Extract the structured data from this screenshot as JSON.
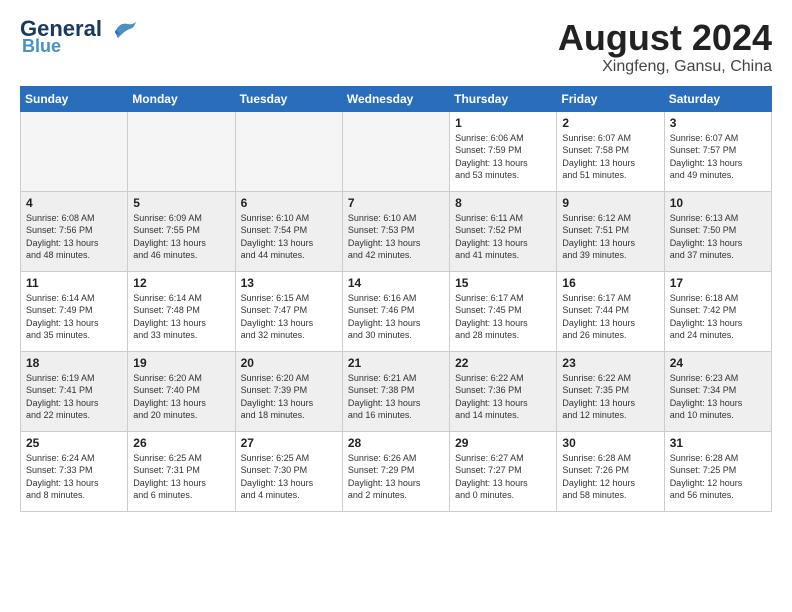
{
  "header": {
    "logo": {
      "line1": "General",
      "line2": "Blue"
    },
    "month": "August 2024",
    "location": "Xingfeng, Gansu, China"
  },
  "weekdays": [
    "Sunday",
    "Monday",
    "Tuesday",
    "Wednesday",
    "Thursday",
    "Friday",
    "Saturday"
  ],
  "weeks": [
    {
      "shaded": false,
      "days": [
        {
          "num": "",
          "info": ""
        },
        {
          "num": "",
          "info": ""
        },
        {
          "num": "",
          "info": ""
        },
        {
          "num": "",
          "info": ""
        },
        {
          "num": "1",
          "info": "Sunrise: 6:06 AM\nSunset: 7:59 PM\nDaylight: 13 hours\nand 53 minutes."
        },
        {
          "num": "2",
          "info": "Sunrise: 6:07 AM\nSunset: 7:58 PM\nDaylight: 13 hours\nand 51 minutes."
        },
        {
          "num": "3",
          "info": "Sunrise: 6:07 AM\nSunset: 7:57 PM\nDaylight: 13 hours\nand 49 minutes."
        }
      ]
    },
    {
      "shaded": true,
      "days": [
        {
          "num": "4",
          "info": "Sunrise: 6:08 AM\nSunset: 7:56 PM\nDaylight: 13 hours\nand 48 minutes."
        },
        {
          "num": "5",
          "info": "Sunrise: 6:09 AM\nSunset: 7:55 PM\nDaylight: 13 hours\nand 46 minutes."
        },
        {
          "num": "6",
          "info": "Sunrise: 6:10 AM\nSunset: 7:54 PM\nDaylight: 13 hours\nand 44 minutes."
        },
        {
          "num": "7",
          "info": "Sunrise: 6:10 AM\nSunset: 7:53 PM\nDaylight: 13 hours\nand 42 minutes."
        },
        {
          "num": "8",
          "info": "Sunrise: 6:11 AM\nSunset: 7:52 PM\nDaylight: 13 hours\nand 41 minutes."
        },
        {
          "num": "9",
          "info": "Sunrise: 6:12 AM\nSunset: 7:51 PM\nDaylight: 13 hours\nand 39 minutes."
        },
        {
          "num": "10",
          "info": "Sunrise: 6:13 AM\nSunset: 7:50 PM\nDaylight: 13 hours\nand 37 minutes."
        }
      ]
    },
    {
      "shaded": false,
      "days": [
        {
          "num": "11",
          "info": "Sunrise: 6:14 AM\nSunset: 7:49 PM\nDaylight: 13 hours\nand 35 minutes."
        },
        {
          "num": "12",
          "info": "Sunrise: 6:14 AM\nSunset: 7:48 PM\nDaylight: 13 hours\nand 33 minutes."
        },
        {
          "num": "13",
          "info": "Sunrise: 6:15 AM\nSunset: 7:47 PM\nDaylight: 13 hours\nand 32 minutes."
        },
        {
          "num": "14",
          "info": "Sunrise: 6:16 AM\nSunset: 7:46 PM\nDaylight: 13 hours\nand 30 minutes."
        },
        {
          "num": "15",
          "info": "Sunrise: 6:17 AM\nSunset: 7:45 PM\nDaylight: 13 hours\nand 28 minutes."
        },
        {
          "num": "16",
          "info": "Sunrise: 6:17 AM\nSunset: 7:44 PM\nDaylight: 13 hours\nand 26 minutes."
        },
        {
          "num": "17",
          "info": "Sunrise: 6:18 AM\nSunset: 7:42 PM\nDaylight: 13 hours\nand 24 minutes."
        }
      ]
    },
    {
      "shaded": true,
      "days": [
        {
          "num": "18",
          "info": "Sunrise: 6:19 AM\nSunset: 7:41 PM\nDaylight: 13 hours\nand 22 minutes."
        },
        {
          "num": "19",
          "info": "Sunrise: 6:20 AM\nSunset: 7:40 PM\nDaylight: 13 hours\nand 20 minutes."
        },
        {
          "num": "20",
          "info": "Sunrise: 6:20 AM\nSunset: 7:39 PM\nDaylight: 13 hours\nand 18 minutes."
        },
        {
          "num": "21",
          "info": "Sunrise: 6:21 AM\nSunset: 7:38 PM\nDaylight: 13 hours\nand 16 minutes."
        },
        {
          "num": "22",
          "info": "Sunrise: 6:22 AM\nSunset: 7:36 PM\nDaylight: 13 hours\nand 14 minutes."
        },
        {
          "num": "23",
          "info": "Sunrise: 6:22 AM\nSunset: 7:35 PM\nDaylight: 13 hours\nand 12 minutes."
        },
        {
          "num": "24",
          "info": "Sunrise: 6:23 AM\nSunset: 7:34 PM\nDaylight: 13 hours\nand 10 minutes."
        }
      ]
    },
    {
      "shaded": false,
      "days": [
        {
          "num": "25",
          "info": "Sunrise: 6:24 AM\nSunset: 7:33 PM\nDaylight: 13 hours\nand 8 minutes."
        },
        {
          "num": "26",
          "info": "Sunrise: 6:25 AM\nSunset: 7:31 PM\nDaylight: 13 hours\nand 6 minutes."
        },
        {
          "num": "27",
          "info": "Sunrise: 6:25 AM\nSunset: 7:30 PM\nDaylight: 13 hours\nand 4 minutes."
        },
        {
          "num": "28",
          "info": "Sunrise: 6:26 AM\nSunset: 7:29 PM\nDaylight: 13 hours\nand 2 minutes."
        },
        {
          "num": "29",
          "info": "Sunrise: 6:27 AM\nSunset: 7:27 PM\nDaylight: 13 hours\nand 0 minutes."
        },
        {
          "num": "30",
          "info": "Sunrise: 6:28 AM\nSunset: 7:26 PM\nDaylight: 12 hours\nand 58 minutes."
        },
        {
          "num": "31",
          "info": "Sunrise: 6:28 AM\nSunset: 7:25 PM\nDaylight: 12 hours\nand 56 minutes."
        }
      ]
    }
  ]
}
